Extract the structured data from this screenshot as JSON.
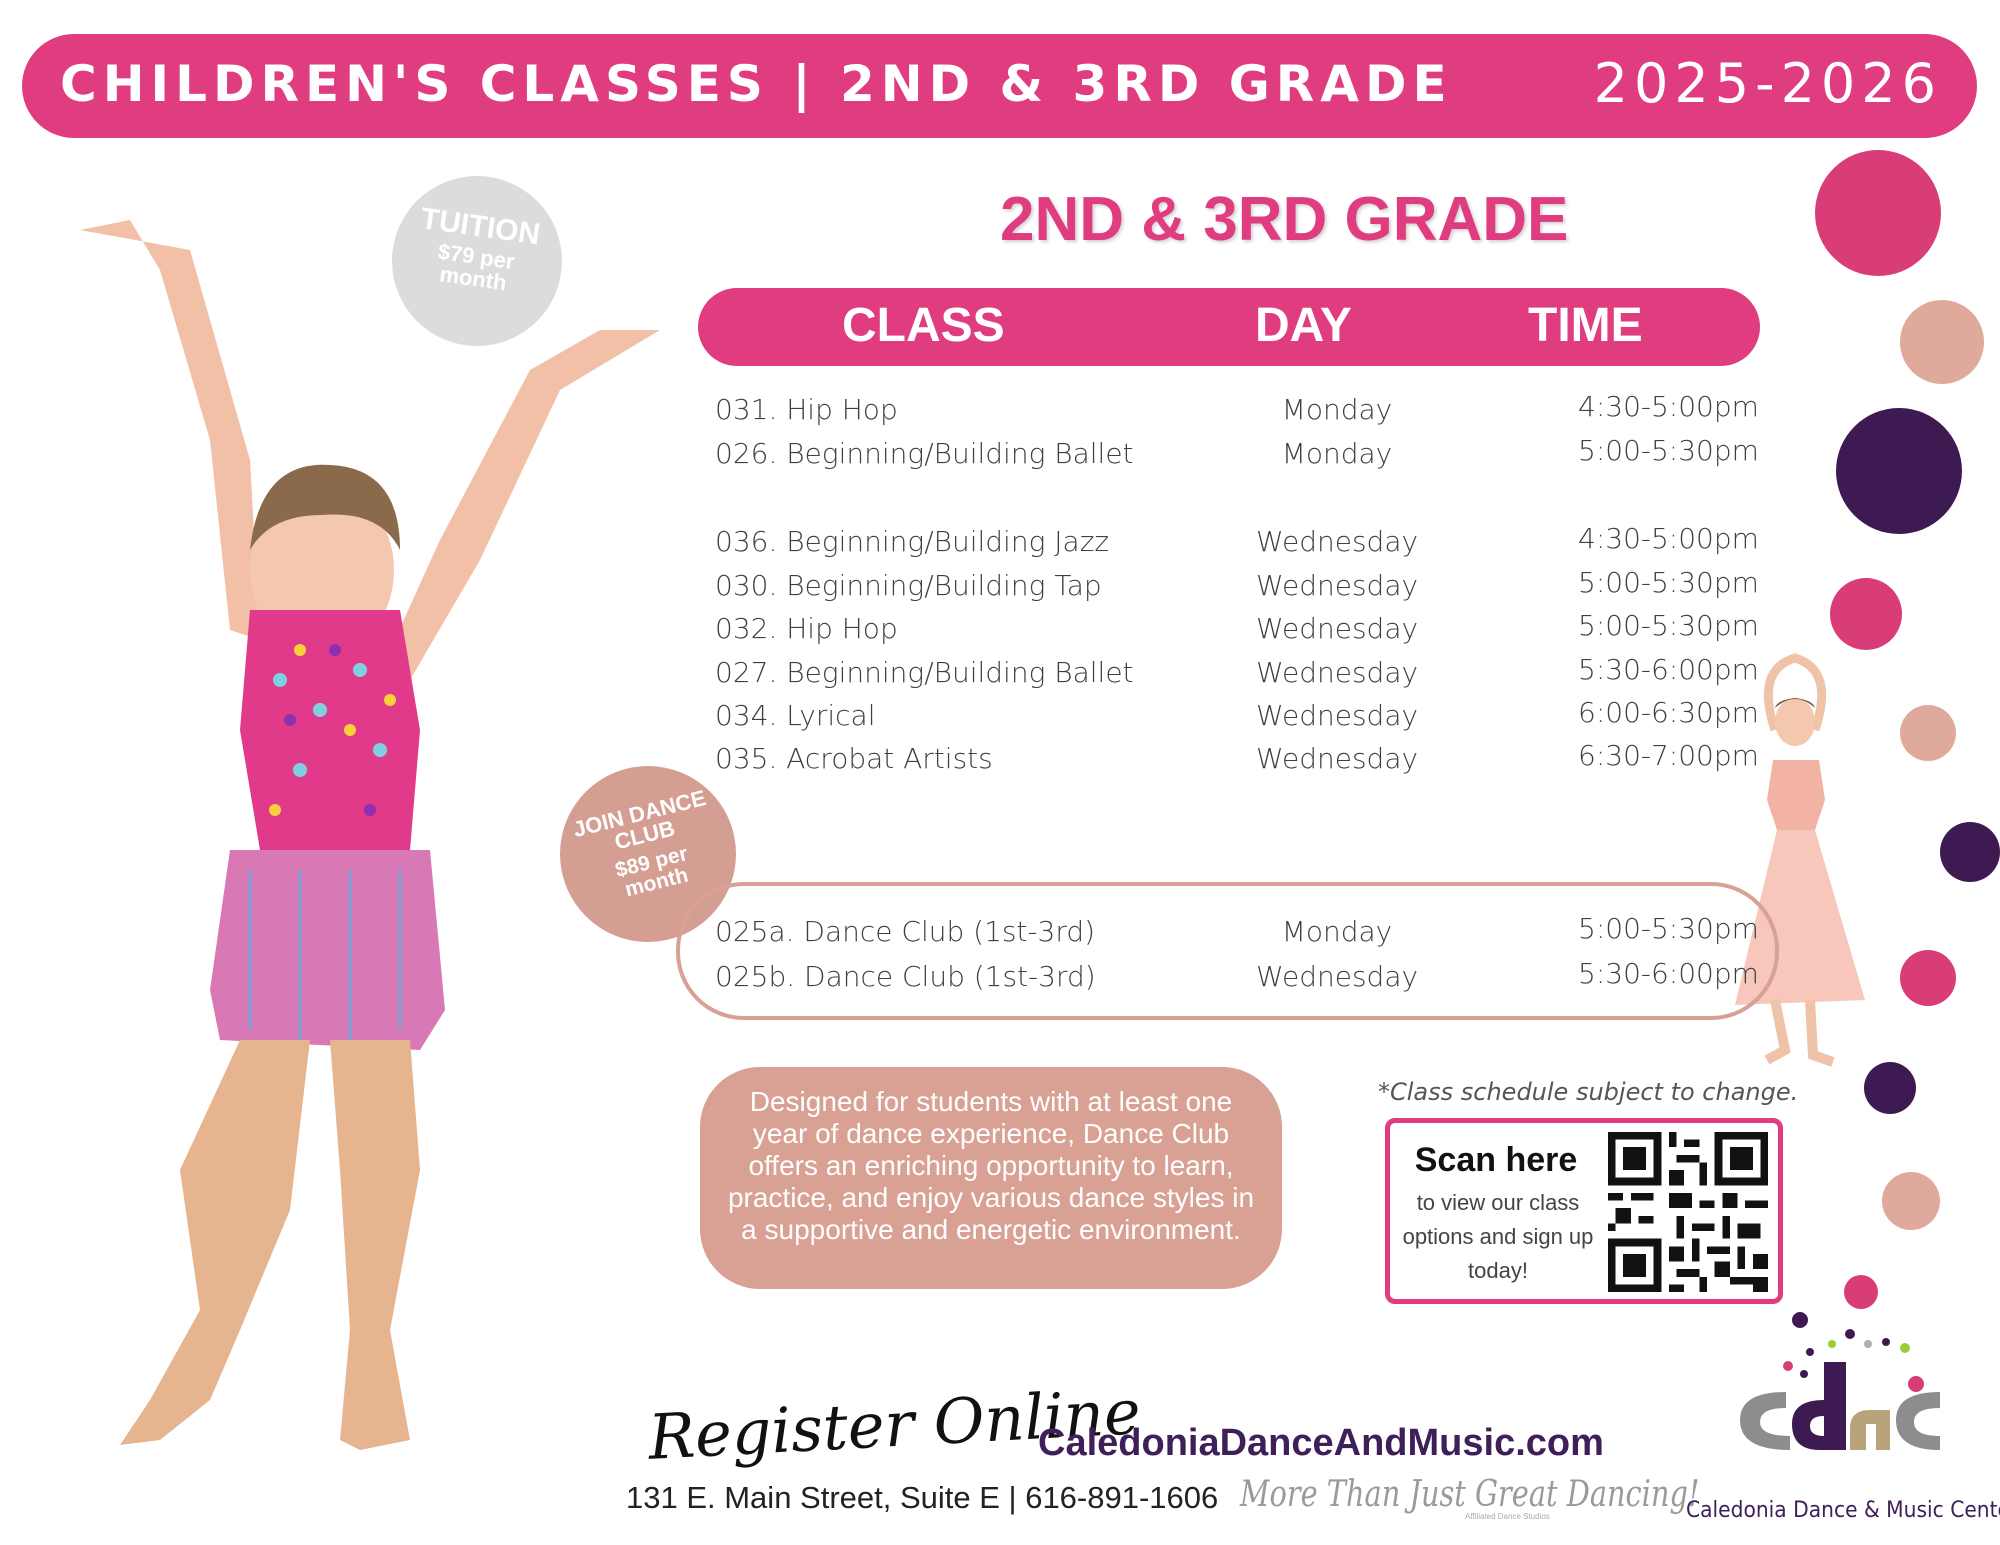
{
  "header": {
    "title": "CHILDREN'S CLASSES | 2ND & 3RD GRADE",
    "year": "2025-2026"
  },
  "section_title": "2ND & 3RD GRADE",
  "table": {
    "headers": {
      "class": "CLASS",
      "day": "DAY",
      "time": "TIME"
    },
    "group1": [
      {
        "class": "031. Hip Hop",
        "day": "Monday",
        "time": "4:30-5:00pm"
      },
      {
        "class": "026. Beginning/Building Ballet",
        "day": "Monday",
        "time": "5:00-5:30pm"
      }
    ],
    "group2": [
      {
        "class": "036. Beginning/Building Jazz",
        "day": "Wednesday",
        "time": "4:30-5:00pm"
      },
      {
        "class": "030. Beginning/Building Tap",
        "day": "Wednesday",
        "time": "5:00-5:30pm"
      },
      {
        "class": "032. Hip Hop",
        "day": "Wednesday",
        "time": "5:00-5:30pm"
      },
      {
        "class": "027. Beginning/Building Ballet",
        "day": "Wednesday",
        "time": "5:30-6:00pm"
      },
      {
        "class": "034. Lyrical",
        "day": "Wednesday",
        "time": "6:00-6:30pm"
      },
      {
        "class": "035. Acrobat Artists",
        "day": "Wednesday",
        "time": "6:30-7:00pm"
      }
    ],
    "dance_club": [
      {
        "class": "025a. Dance Club (1st-3rd)",
        "day": "Monday",
        "time": "5:00-5:30pm"
      },
      {
        "class": "025b. Dance Club (1st-3rd)",
        "day": "Wednesday",
        "time": "5:30-6:00pm"
      }
    ]
  },
  "badges": {
    "tuition_title": "TUITION",
    "tuition_price": "$79 per",
    "tuition_unit": "month",
    "club_title1": "JOIN DANCE",
    "club_title2": "CLUB",
    "club_price": "$89 per",
    "club_unit": "month"
  },
  "description": "Designed for students with at least one year of dance experience, Dance Club offers an enriching opportunity to learn, practice, and enjoy various dance styles in a supportive and energetic environment.",
  "note": "*Class schedule subject to change.",
  "qr": {
    "title": "Scan here",
    "subtitle": "to view our class options and sign up today!"
  },
  "footer": {
    "register": "Register Online",
    "website": "CaledoniaDanceAndMusic.com",
    "address": "131 E. Main Street, Suite E | 616-891-1606",
    "tagline": "More Than Just Great Dancing!",
    "affiliated": "Affiliated Dance Studios",
    "logo_name": "Caledonia Dance & Music Center"
  },
  "colors": {
    "pink": "#e03c80",
    "rose": "#d9a094",
    "plum": "#3e1f59",
    "gray": "#dcdcdc"
  },
  "icons": [
    "dancer-girl-photo",
    "ballet-girl-photo",
    "qr-code-icon",
    "cdmc-logo"
  ]
}
